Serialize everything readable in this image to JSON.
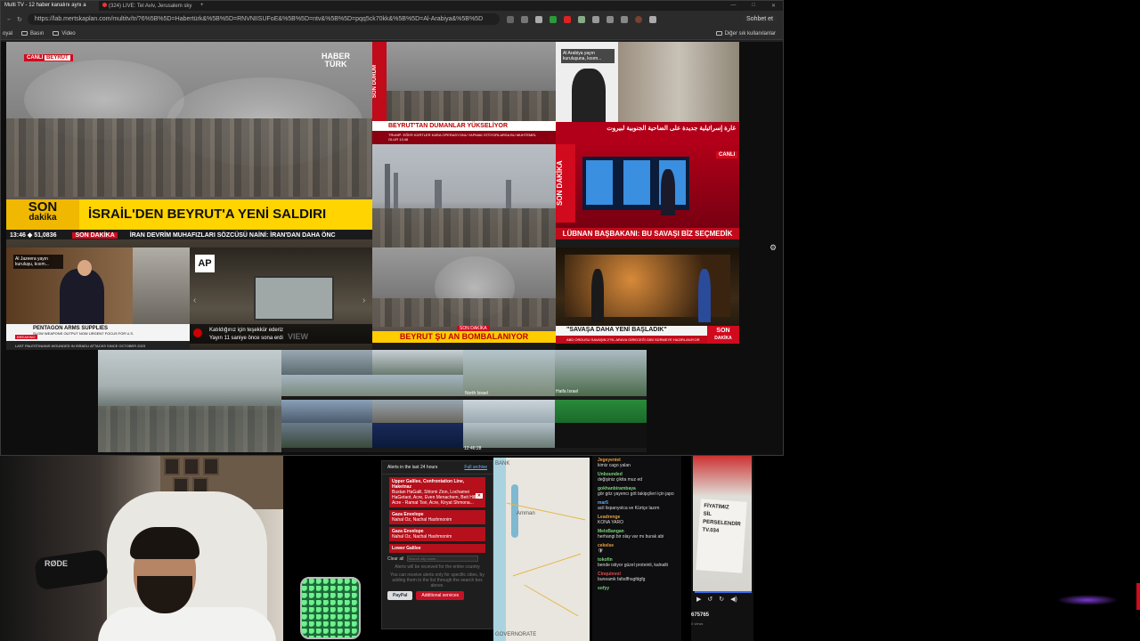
{
  "browser": {
    "tabs": [
      {
        "label": "Multi TV - 12 haber kanalını aynı a"
      },
      {
        "label": "(324) LIVE: Tel Aviv, Jerusalem sky"
      }
    ],
    "new_tab": "+",
    "url": "https://lab.mertskaplan.com/multitv/tr/?6%5B%5D=Habertürk&%5B%5D=RNVNIISUFoE&%5B%5D=ntv&%5B%5D=pqq5ck70kk&%5B%5D=Al-Arabiya&%5B%5D",
    "chat_button": "Sohbet et",
    "bookmarks": [
      {
        "label": "oyal"
      },
      {
        "label": "Basın"
      },
      {
        "label": "Video"
      }
    ],
    "other_bookmarks": "Diğer sık kullanılanlar"
  },
  "tiles": {
    "haberturk": {
      "logo_line1": "HABER",
      "logo_line2": "TÜRK",
      "live": "CANLI",
      "location": "BEYRUT",
      "son": "SON",
      "dakika": "dakika",
      "headline": "İSRAİL'DEN BEYRUT'A YENİ SALDIRI",
      "time": "13:46",
      "index": "51,0836",
      "ticker_label": "SON DAKİKA",
      "ticker": "İRAN DEVRİM MUHAFIZLARI SÖZCÜSÜ NAİNİ: İRAN'DAN DAHA ÖNC"
    },
    "ntv": {
      "side": "SON DURUM",
      "headline": "BEYRUT'TAN DUMANLAR YÜKSELİYOR",
      "sub": "TRUMP: EĞER KÜRTLER KARA OPERASYONU YAPMAK İSTİYORLARSA BU MUHTEMEL OLUR",
      "time": "13:46"
    },
    "alarabiya": {
      "notice": "Al Arabiya yayın kuruluşuna, kısım...",
      "headline": "غارة إسرائيلية جديدة على الضاحية الجنوبية لبيروت"
    },
    "tv100": {
      "side": "SON DAKİKA",
      "headline": "LÜBNAN BAŞBAKANI: BU SAVAŞI BİZ SEÇMEDİK",
      "live": "CANLI"
    },
    "aljazeera": {
      "notice": "Al Jazeera yayın kuruluşu, kısım...",
      "headline": "PENTAGON ARMS SUPPLIES",
      "sub": "SLOW WEAPONS OUTPUT NOW URGENT FOCUS FOR U.S.",
      "breaking": "BREAKING",
      "ticker": "LAST PALESTINIANS WOUNDED IN ISRAELI ATTACKS SINCE OCTOBER 2023"
    },
    "ap": {
      "logo": "AP",
      "thanks": "Katıldığınız için teşekkür ederiz",
      "saved": "Yayın 11 saniye önce sona erdi",
      "view": "VIEW"
    },
    "skyline": {},
    "beyrut2": {
      "son_dakika": "SON DAKİKA",
      "headline": "BEYRUT ŞU AN BOMBALANIYOR"
    },
    "studio": {
      "headline": "\"SAVAŞA DAHA YENİ BAŞLADIK\"",
      "sub": "ABD ORDUSU SAVAŞIN 2'YİL ARAYA GİRECEĞİ GİBİ SÜRMEYE HAZIRLANIYOR",
      "son": "SON",
      "dakika": "DAKİKA"
    },
    "multicam": {
      "labels": [
        "North Israel",
        "Haifa Israel"
      ],
      "time": "12:46:28"
    }
  },
  "alerts": {
    "title": "Alerts in the last 24 hours",
    "full_archive": "Full archive",
    "items": [
      {
        "title": "Upper Galilee, Confrontation Line, Haketnaz",
        "body": "Bustan HaGalil, Shlomi Zion, Lochamei HaGetaot, Acre, Even Menachem, Beit Hillel, Acre - Ramat Tsvi, Acre, Kiryat Shmona..."
      },
      {
        "title": "Gaza Envelope",
        "body": "Nahal Oz, Nachal Hashmonim"
      },
      {
        "title": "Gaza Envelope",
        "body": "Nahal Oz, Nachal Hashmonim"
      },
      {
        "title": "Lower Galilee",
        "body": ""
      }
    ],
    "clear": "Clear all",
    "search_placeholder": "Search city name...",
    "note": "Alerts will be received for the entire country",
    "note2": "You can receive alerts only for specific cities, by adding them to the list through the search box above.",
    "paypal": "PayPal",
    "additional": "Additional services"
  },
  "map": {
    "labels": [
      "Amman",
      "BANK",
      "GOVERNORATE"
    ]
  },
  "chat": {
    "messages": [
      {
        "user": "Jegeyeniet",
        "text": "kimiz cago yalan",
        "color": "o"
      },
      {
        "user": "Unbounded",
        "text": "değişiniz çikita muz ed",
        "color": ""
      },
      {
        "user": "gokhanbirambaya",
        "text": "gör göz yayencı göt takipçileri için japo",
        "color": ""
      },
      {
        "user": "mar5",
        "text": "acil lispanyolca ve Kürtçe lazım",
        "color": "b"
      },
      {
        "user": "Leadrenge",
        "text": "KONA YARO",
        "color": "o"
      },
      {
        "user": "MeloBangan",
        "text": "herhangi bir olay var mı burak abi",
        "color": ""
      },
      {
        "user": "cekelse",
        "text": "🛡",
        "color": "o"
      },
      {
        "user": "tokofin",
        "text": "bende istiyor güzel proteinli, kalnalti",
        "color": ""
      },
      {
        "user": "Cinquinvol",
        "text": "buneamk fafsdfhsgfdgfg",
        "color": "r"
      },
      {
        "user": "sofyy",
        "text": "",
        "color": ""
      }
    ]
  },
  "video": {
    "card_text": [
      "FİYATIMIZ",
      "SİL",
      "PERSELENDİR",
      "TV.034"
    ],
    "views": "675765",
    "views_sub": "0 views"
  }
}
